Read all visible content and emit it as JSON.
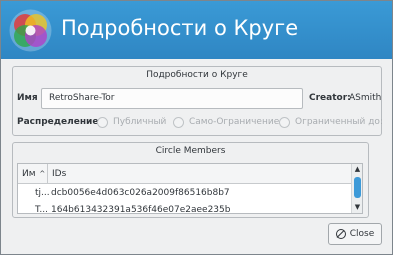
{
  "window": {
    "title": "Подробности о Круге"
  },
  "details": {
    "group_title": "Подробности о Круге",
    "name_label": "Имя",
    "name_value": "RetroShare-Tor",
    "creator_label": "Creator:",
    "creator_value": "ASmith",
    "distribution_label": "Распределение",
    "options": [
      "Публичный",
      "Само-Ограничение",
      "Ограниченный до:"
    ]
  },
  "members": {
    "group_title": "Circle Members",
    "columns": [
      "Им",
      "IDs"
    ],
    "rows": [
      {
        "name": "tj...",
        "id": "dcb0056e4d063c026a2009f86516b8b7"
      },
      {
        "name": "T...",
        "id": "164b613432391a536f46e07e2aee235b"
      }
    ]
  },
  "buttons": {
    "close": "Close"
  }
}
